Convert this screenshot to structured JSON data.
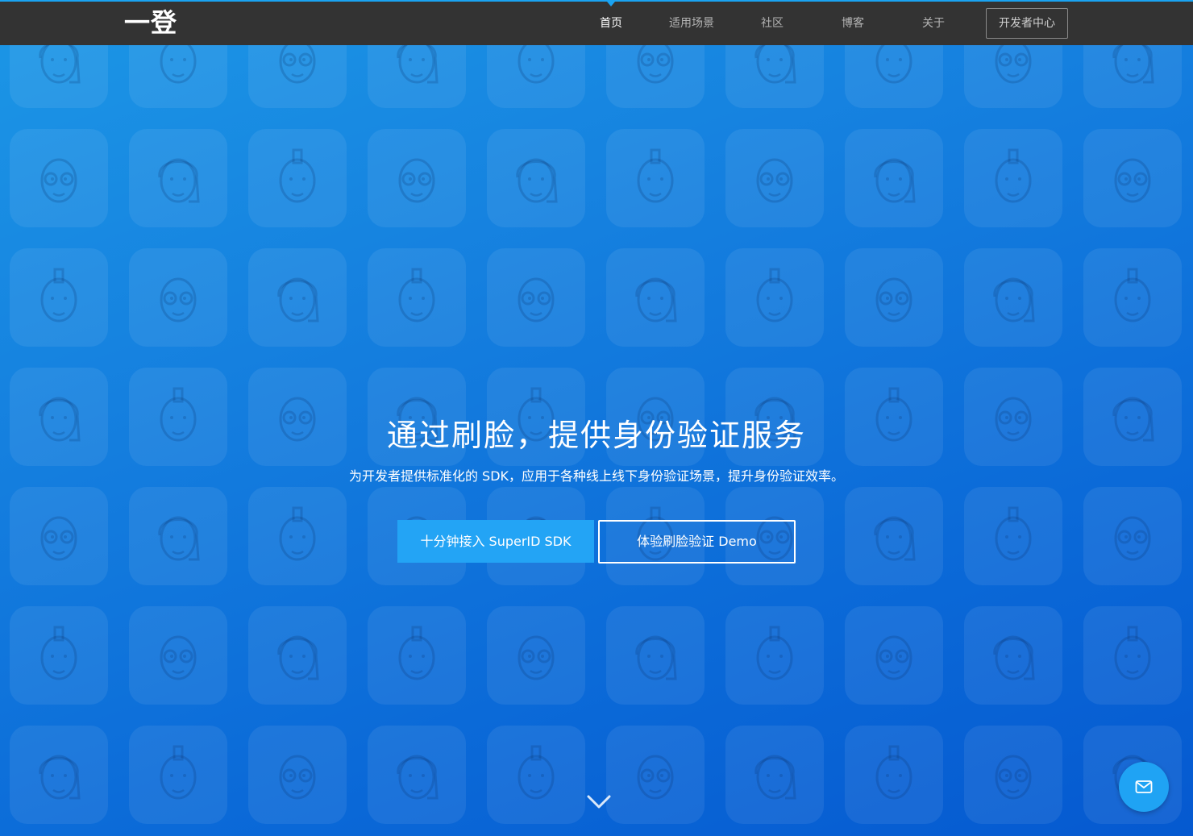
{
  "nav": {
    "logo": "一登",
    "items": [
      {
        "label": "首页",
        "active": true
      },
      {
        "label": "适用场景",
        "active": false
      },
      {
        "label": "社区",
        "active": false
      },
      {
        "label": "博客",
        "active": false
      },
      {
        "label": "关于",
        "active": false
      }
    ],
    "dev_center": "开发者中心"
  },
  "hero": {
    "title": "通过刷脸，提供身份验证服务",
    "subtitle": "为开发者提供标准化的 SDK，应用于各种线上线下身份验证场景，提升身份验证效率。",
    "primary_button": "十分钟接入 SuperID SDK",
    "secondary_button": "体验刷脸验证 Demo"
  },
  "icons": {
    "scroll_down": "chevron-down-icon",
    "contact": "envelope-icon",
    "background": "avatar-face-icon"
  },
  "colors": {
    "navbar": "#333333",
    "accent": "#1aa3f2",
    "hero_bg_start": "#1c97e6",
    "hero_bg_end": "#0559d0",
    "primary_button": "#23a4f5"
  }
}
